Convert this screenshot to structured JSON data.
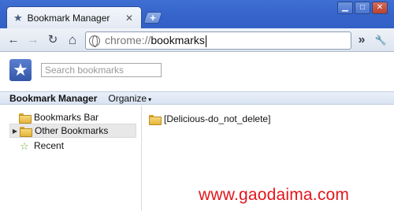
{
  "tab": {
    "title": "Bookmark Manager",
    "close_glyph": "✕",
    "new_tab_glyph": "+"
  },
  "window_controls": {
    "minimize": "▁",
    "maximize": "□",
    "close": "✕"
  },
  "toolbar": {
    "back_glyph": "←",
    "forward_glyph": "→",
    "reload_glyph": "↻",
    "home_glyph": "⌂",
    "overflow_glyph": "»",
    "wrench_glyph": "🔧"
  },
  "omnibox": {
    "scheme": "chrome://",
    "host": "bookmarks"
  },
  "search": {
    "placeholder": "Search bookmarks"
  },
  "header": {
    "title": "Bookmark Manager",
    "organize": "Organize",
    "organize_arrow": "▾"
  },
  "tree": [
    {
      "label": "Bookmarks Bar",
      "icon": "folder-icon",
      "expandable": false
    },
    {
      "label": "Other Bookmarks",
      "icon": "folder-icon",
      "expandable": true
    },
    {
      "label": "Recent",
      "icon": "star-icon",
      "expandable": false
    }
  ],
  "list": [
    {
      "label": "[Delicious-do_not_delete]",
      "icon": "folder-icon"
    }
  ],
  "watermark": "www.gaodaima.com",
  "colors": {
    "titlebar": "#3563c9",
    "folder": "#e5b43a",
    "watermark": "#e3151c"
  }
}
